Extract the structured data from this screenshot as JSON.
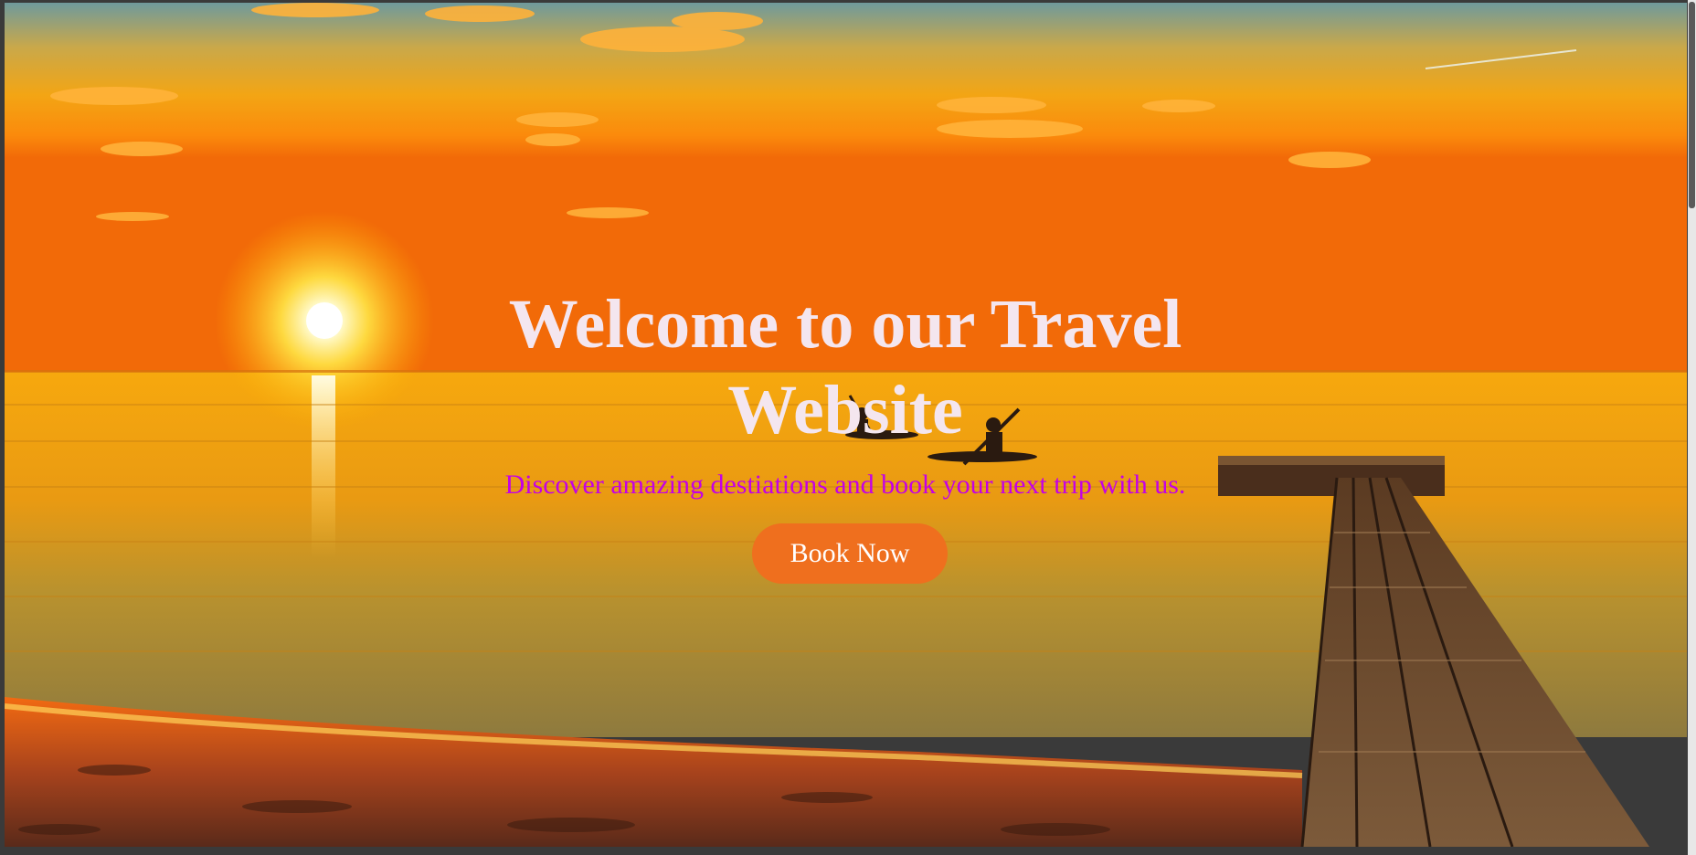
{
  "hero": {
    "title": "Welcome to our Travel Website",
    "subtitle": "Discover amazing destiations and book your next trip with us.",
    "button_label": "Book Now",
    "background": "sunset-beach-with-pier-and-kayakers"
  },
  "colors": {
    "title": "#f4e6ef",
    "subtitle": "#c400e6",
    "button": "#ef6f1e",
    "button_text": "#ffffff"
  }
}
